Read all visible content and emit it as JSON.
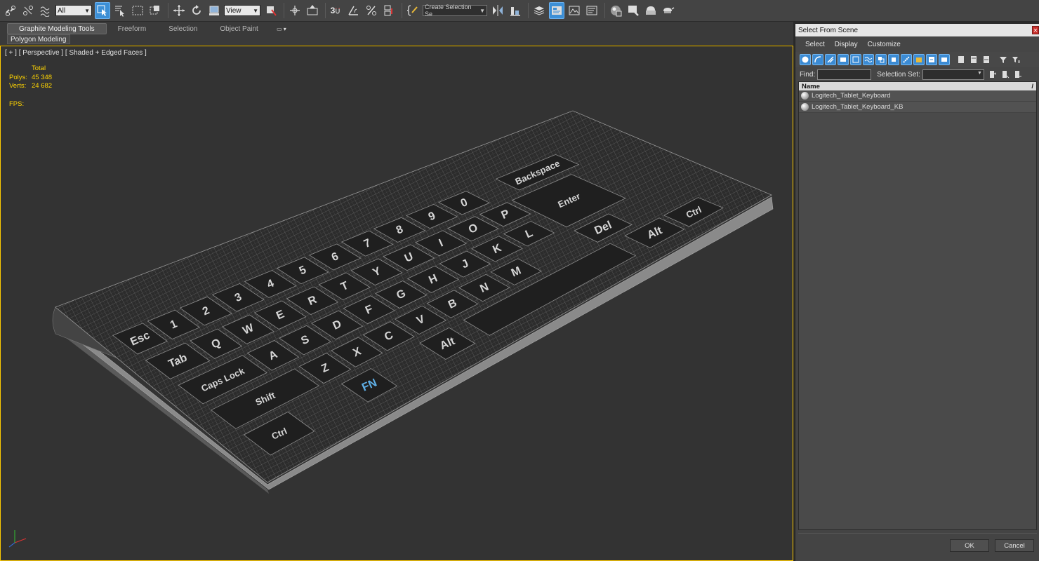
{
  "toolbar": {
    "selection_filter": "All",
    "ref_coord": "View",
    "snap_label": "3",
    "named_selection_placeholder": "Create Selection Se"
  },
  "ribbon": {
    "tabs": [
      "Graphite Modeling Tools",
      "Freeform",
      "Selection",
      "Object Paint"
    ],
    "active_tab": 0,
    "sub_label": "Polygon Modeling"
  },
  "viewport": {
    "label": "[ + ] [ Perspective ] [ Shaded + Edged Faces ]",
    "stats": {
      "header": "Total",
      "polys_label": "Polys:",
      "polys_value": "45 348",
      "verts_label": "Verts:",
      "verts_value": "24 682",
      "fps_label": "FPS:"
    },
    "keyboard": {
      "keys": [
        "Esc",
        "Tab",
        "Caps Lock",
        "Shift",
        "Ctrl",
        "FN",
        "Alt",
        "Q",
        "W",
        "E",
        "R",
        "T",
        "Y",
        "U",
        "I",
        "O",
        "P",
        "A",
        "S",
        "D",
        "F",
        "G",
        "H",
        "J",
        "K",
        "L",
        "Z",
        "X",
        "C",
        "V",
        "B",
        "N",
        "M",
        "1",
        "2",
        "3",
        "4",
        "5",
        "6",
        "7",
        "8",
        "9",
        "0",
        "Enter",
        "Backspace",
        "Del",
        "Alt",
        "Ctrl"
      ]
    }
  },
  "dialog": {
    "title": "Select From Scene",
    "menu": [
      "Select",
      "Display",
      "Customize"
    ],
    "find_label": "Find:",
    "find_value": "",
    "selset_label": "Selection Set:",
    "selset_value": "",
    "column_name": "Name",
    "rows": [
      "Logitech_Tablet_Keyboard",
      "Logitech_Tablet_Keyboard_KB"
    ],
    "ok_label": "OK",
    "cancel_label": "Cancel"
  },
  "colors": {
    "accent": "#3c8fd6",
    "viewport_border": "#ffcc00",
    "stats_text": "#ffd400"
  }
}
